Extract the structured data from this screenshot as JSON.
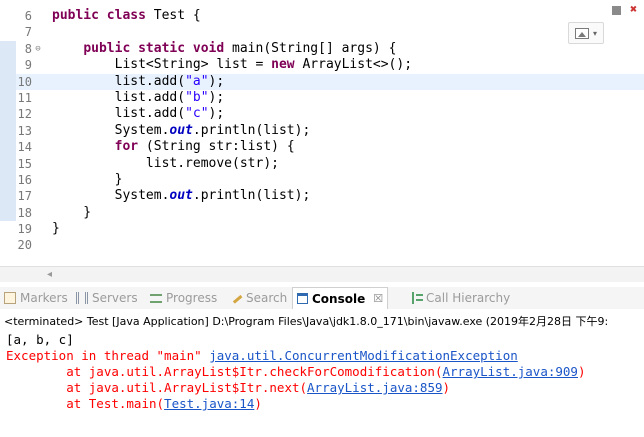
{
  "editor": {
    "lines": [
      {
        "n": "6",
        "fold": "",
        "current": false,
        "changed": false,
        "tokens": [
          {
            "t": "public class",
            "c": "k"
          },
          {
            "t": " Test {",
            "c": ""
          }
        ]
      },
      {
        "n": "7",
        "fold": "",
        "current": false,
        "changed": false,
        "tokens": []
      },
      {
        "n": "8",
        "fold": "⊖",
        "current": false,
        "changed": true,
        "tokens": [
          {
            "t": "    ",
            "c": ""
          },
          {
            "t": "public static void",
            "c": "k"
          },
          {
            "t": " main(String[] args) {",
            "c": ""
          }
        ]
      },
      {
        "n": "9",
        "fold": "",
        "current": false,
        "changed": true,
        "tokens": [
          {
            "t": "        List<String> list = ",
            "c": ""
          },
          {
            "t": "new",
            "c": "k"
          },
          {
            "t": " ArrayList<>();",
            "c": ""
          }
        ]
      },
      {
        "n": "10",
        "fold": "",
        "current": true,
        "changed": true,
        "tokens": [
          {
            "t": "        list.add(",
            "c": ""
          },
          {
            "t": "\"a\"",
            "c": "s"
          },
          {
            "t": ");",
            "c": ""
          }
        ]
      },
      {
        "n": "11",
        "fold": "",
        "current": false,
        "changed": true,
        "tokens": [
          {
            "t": "        list.add(",
            "c": ""
          },
          {
            "t": "\"b\"",
            "c": "s"
          },
          {
            "t": ");",
            "c": ""
          }
        ]
      },
      {
        "n": "12",
        "fold": "",
        "current": false,
        "changed": true,
        "tokens": [
          {
            "t": "        list.add(",
            "c": ""
          },
          {
            "t": "\"c\"",
            "c": "s"
          },
          {
            "t": ");",
            "c": ""
          }
        ]
      },
      {
        "n": "13",
        "fold": "",
        "current": false,
        "changed": true,
        "tokens": [
          {
            "t": "        System.",
            "c": ""
          },
          {
            "t": "out",
            "c": "st"
          },
          {
            "t": ".println(list);",
            "c": ""
          }
        ]
      },
      {
        "n": "14",
        "fold": "",
        "current": false,
        "changed": true,
        "tokens": [
          {
            "t": "        ",
            "c": ""
          },
          {
            "t": "for",
            "c": "k"
          },
          {
            "t": " (String str:list) {",
            "c": ""
          }
        ]
      },
      {
        "n": "15",
        "fold": "",
        "current": false,
        "changed": true,
        "tokens": [
          {
            "t": "            list.remove(str);",
            "c": ""
          }
        ]
      },
      {
        "n": "16",
        "fold": "",
        "current": false,
        "changed": true,
        "tokens": [
          {
            "t": "        }",
            "c": ""
          }
        ]
      },
      {
        "n": "17",
        "fold": "",
        "current": false,
        "changed": true,
        "tokens": [
          {
            "t": "        System.",
            "c": ""
          },
          {
            "t": "out",
            "c": "st"
          },
          {
            "t": ".println(list);",
            "c": ""
          }
        ]
      },
      {
        "n": "18",
        "fold": "",
        "current": false,
        "changed": true,
        "tokens": [
          {
            "t": "    }",
            "c": ""
          }
        ]
      },
      {
        "n": "19",
        "fold": "",
        "current": false,
        "changed": false,
        "tokens": [
          {
            "t": "}",
            "c": ""
          }
        ]
      },
      {
        "n": "20",
        "fold": "",
        "current": false,
        "changed": false,
        "tokens": []
      }
    ],
    "toolbar_icon": "image-icon",
    "toolbar_dropdown": "▾",
    "scroll_left_arrow": "◂"
  },
  "views": {
    "tabs": [
      {
        "id": "markers",
        "label": "Markers",
        "icon": "markers-icon",
        "active": false
      },
      {
        "id": "servers",
        "label": "Servers",
        "icon": "servers-icon",
        "active": false
      },
      {
        "id": "progress",
        "label": "Progress",
        "icon": "progress-icon",
        "active": false
      },
      {
        "id": "search",
        "label": "Search",
        "icon": "search-icon",
        "active": false
      },
      {
        "id": "console",
        "label": "Console",
        "icon": "console-icon",
        "active": true,
        "close": "☒"
      },
      {
        "id": "callh",
        "label": "Call Hierarchy",
        "icon": "call-hierarchy-icon",
        "active": false
      }
    ]
  },
  "console": {
    "header": "<terminated> Test [Java Application] D:\\Program Files\\Java\\jdk1.8.0_171\\bin\\javaw.exe (2019年2月28日 下午9:",
    "lines": [
      {
        "type": "out",
        "parts": [
          {
            "t": "[a, b, c]"
          }
        ]
      },
      {
        "type": "err",
        "parts": [
          {
            "t": "Exception in thread \"main\" "
          },
          {
            "t": "java.util.ConcurrentModificationException",
            "link": true
          }
        ]
      },
      {
        "type": "err",
        "parts": [
          {
            "t": "        at java.util.ArrayList$Itr.checkForComodification("
          },
          {
            "t": "ArrayList.java:909",
            "link": true
          },
          {
            "t": ")"
          }
        ]
      },
      {
        "type": "err",
        "parts": [
          {
            "t": "        at java.util.ArrayList$Itr.next("
          },
          {
            "t": "ArrayList.java:859",
            "link": true
          },
          {
            "t": ")"
          }
        ]
      },
      {
        "type": "err",
        "parts": [
          {
            "t": "        at Test.main("
          },
          {
            "t": "Test.java:14",
            "link": true
          },
          {
            "t": ")"
          }
        ]
      }
    ]
  }
}
